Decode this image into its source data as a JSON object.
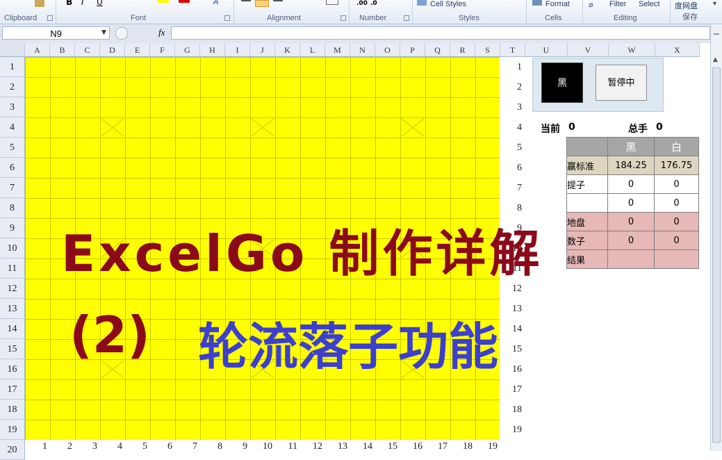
{
  "ribbon": {
    "groups": [
      {
        "label": "Clipboard"
      },
      {
        "label": "Font"
      },
      {
        "label": "Alignment"
      },
      {
        "label": "Number"
      },
      {
        "label": "Styles",
        "item": "Cell Styles"
      },
      {
        "label": "Cells",
        "item": "Format"
      },
      {
        "label": "Editing",
        "item_filter": "Filter",
        "item_select": "Select"
      },
      {
        "label": "保存",
        "item": "度网盘"
      }
    ]
  },
  "formula_bar": {
    "name_box": "N9",
    "fx": "fx",
    "content": ""
  },
  "columns": [
    "A",
    "B",
    "C",
    "D",
    "E",
    "F",
    "G",
    "H",
    "I",
    "J",
    "K",
    "L",
    "M",
    "N",
    "O",
    "P",
    "Q",
    "R",
    "S",
    "T",
    "U",
    "V",
    "W",
    "X"
  ],
  "rows": [
    "1",
    "2",
    "3",
    "4",
    "5",
    "6",
    "7",
    "8",
    "9",
    "10",
    "11",
    "12",
    "13",
    "14",
    "15",
    "16",
    "17",
    "18",
    "19",
    "20"
  ],
  "board": {
    "row_numbers": [
      "1",
      "2",
      "3",
      "4",
      "5",
      "6",
      "7",
      "8",
      "9",
      "10",
      "11",
      "12",
      "13",
      "14",
      "15",
      "16",
      "17",
      "18",
      "19"
    ],
    "col_numbers": [
      "1",
      "2",
      "3",
      "4",
      "5",
      "6",
      "7",
      "8",
      "9",
      "10",
      "11",
      "12",
      "13",
      "14",
      "15",
      "16",
      "17",
      "18",
      "19"
    ]
  },
  "controls": {
    "black_button": "黑",
    "pause_button": "暂停中"
  },
  "status": {
    "current_label": "当前",
    "current_value": "0",
    "total_label": "总手",
    "total_value": "0"
  },
  "stats": {
    "header": [
      "",
      "黑",
      "白"
    ],
    "rows": [
      [
        "赢标准",
        "184.25",
        "176.75"
      ],
      [
        "提子",
        "0",
        "0"
      ],
      [
        "",
        "0",
        "0"
      ],
      [
        "地盘",
        "0",
        "0"
      ],
      [
        "数子",
        "0",
        "0"
      ],
      [
        "结果",
        "",
        ""
      ]
    ]
  },
  "overlay": {
    "line1": "ExcelGo 制作详解",
    "line2_num": "(2)",
    "line2_text": "轮流落子功能"
  },
  "colors": {
    "board": "#ffff00",
    "title_red": "#8b0a1a",
    "title_blue": "#3c3fcf",
    "header_gray": "#a6a6a6",
    "row_tan": "#ddd5bf",
    "row_pink": "#e6b8b7"
  }
}
